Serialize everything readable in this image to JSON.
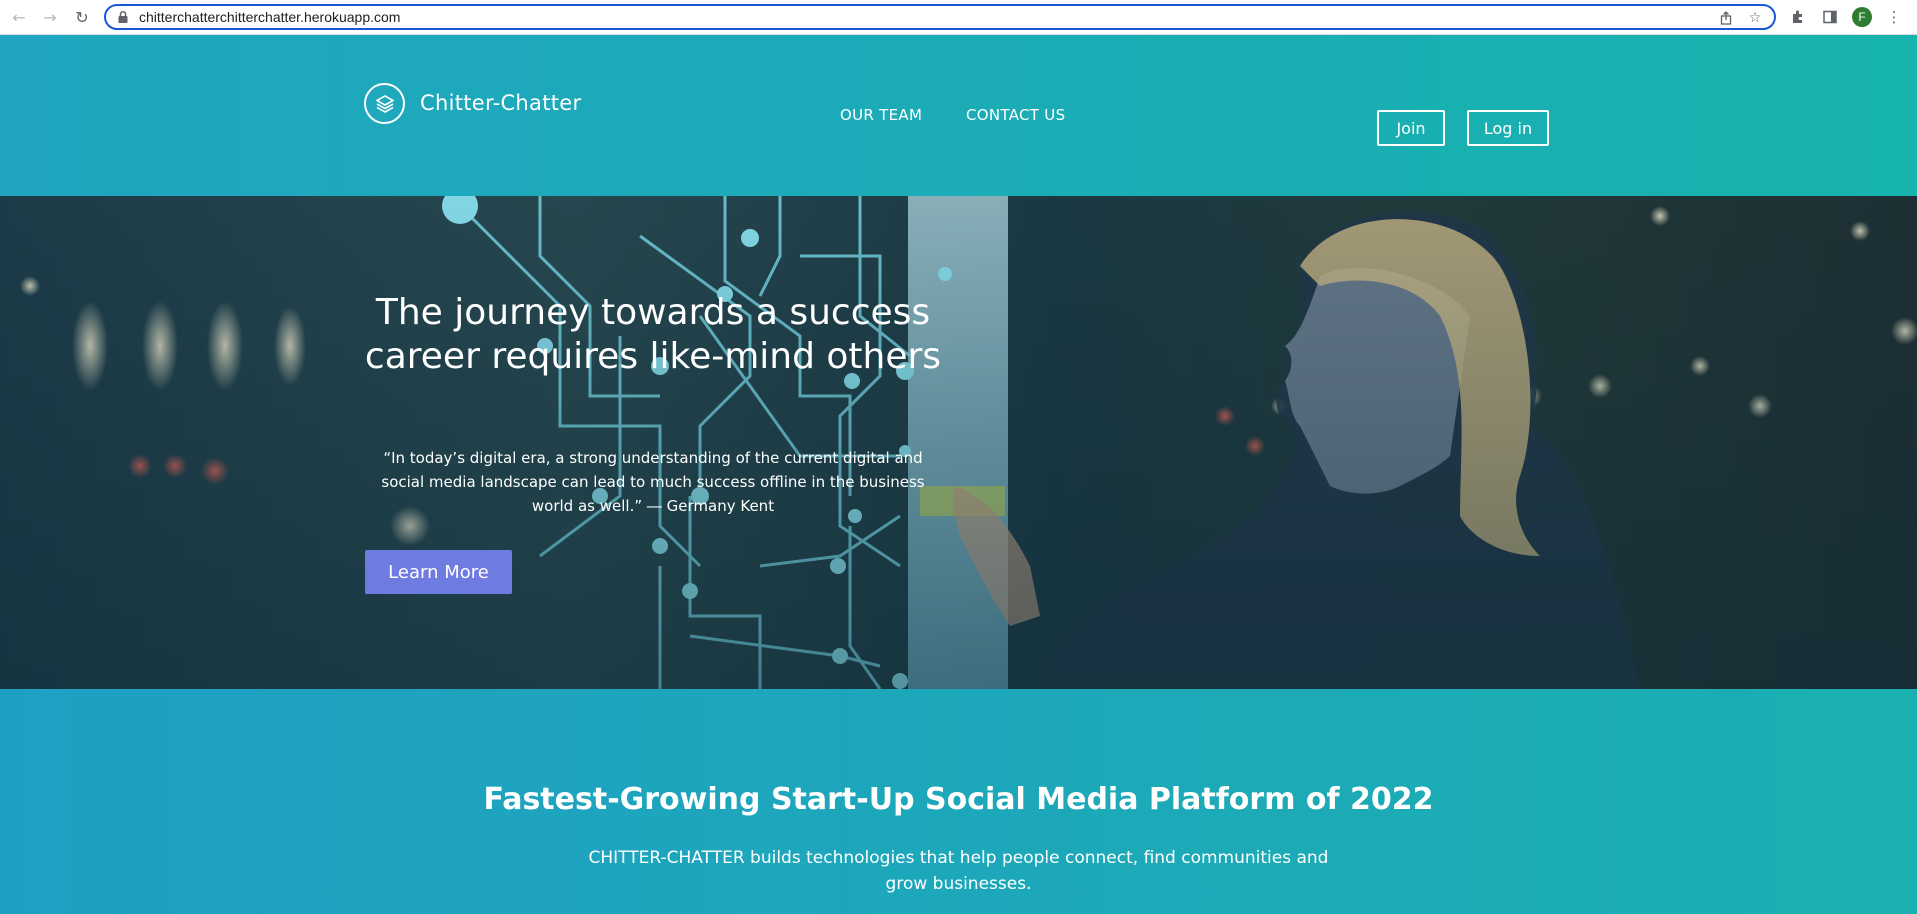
{
  "browser": {
    "url": "chitterchatterchitterchatter.herokuapp.com",
    "profile_initial": "F"
  },
  "header": {
    "brand": "Chitter-Chatter",
    "nav": [
      {
        "label": "OUR TEAM"
      },
      {
        "label": "CONTACT US"
      }
    ],
    "join_label": "Join",
    "login_label": "Log in"
  },
  "hero": {
    "title": "The journey towards a success career requires like-mind others",
    "quote": "“In today’s digital era, a strong understanding of the current digital and social media landscape can lead to much success offline in the business world as well.” ― Germany Kent",
    "cta_label": "Learn More"
  },
  "section": {
    "title": "Fastest-Growing Start-Up Social Media Platform of 2022",
    "text": "CHITTER-CHATTER builds technologies that help people connect, find communities and grow businesses."
  },
  "colors": {
    "header_start": "#1fa5c0",
    "header_end": "#17b3ad",
    "cta": "#6e7be0",
    "omnibox_border": "#1a56d6"
  }
}
